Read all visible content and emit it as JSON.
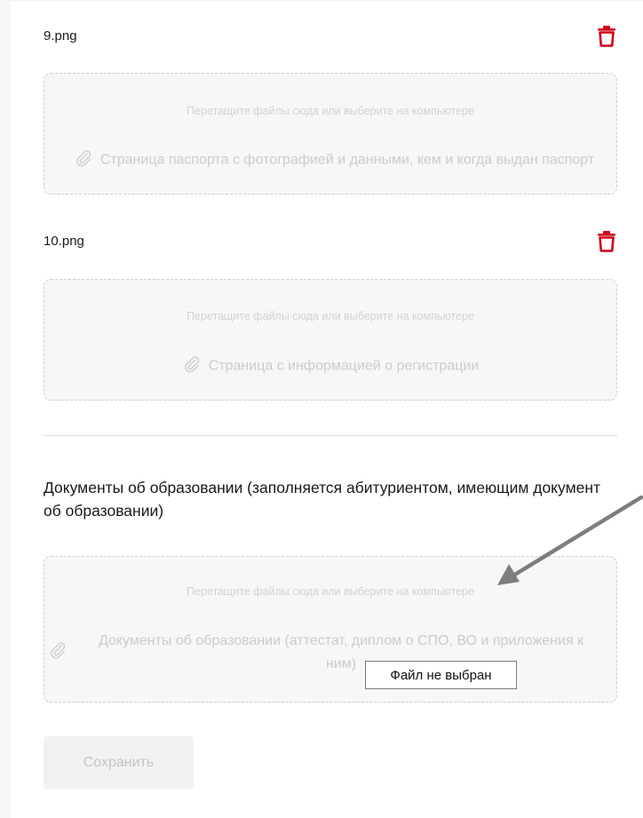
{
  "files": [
    {
      "name": "9.png",
      "drop_hint": "Перетащите файлы сюда или выберите на компьютере",
      "caption": "Страница паспорта с фотографией и данными, кем и когда выдан паспорт"
    },
    {
      "name": "10.png",
      "drop_hint": "Перетащите файлы сюда или выберите на компьютере",
      "caption": "Страница с информацией о регистрации"
    }
  ],
  "education": {
    "title": "Документы об образовании (заполняется абитуриентом, имеющим документ об образовании)",
    "drop_hint": "Перетащите файлы сюда или выберите на компьютере",
    "caption_line1": "Документы об образовании (аттестат, диплом о СПО, ВО и приложения к",
    "caption_line2": "ним)",
    "tooltip": "Файл не выбран"
  },
  "save_label": "Сохранить",
  "colors": {
    "delete_icon": "#d0021b",
    "arrow": "#7d7d7d",
    "drop_bg": "#f7f7f7",
    "muted_text": "#cbcbcb"
  },
  "icons": [
    "trash-icon",
    "paperclip-icon"
  ]
}
